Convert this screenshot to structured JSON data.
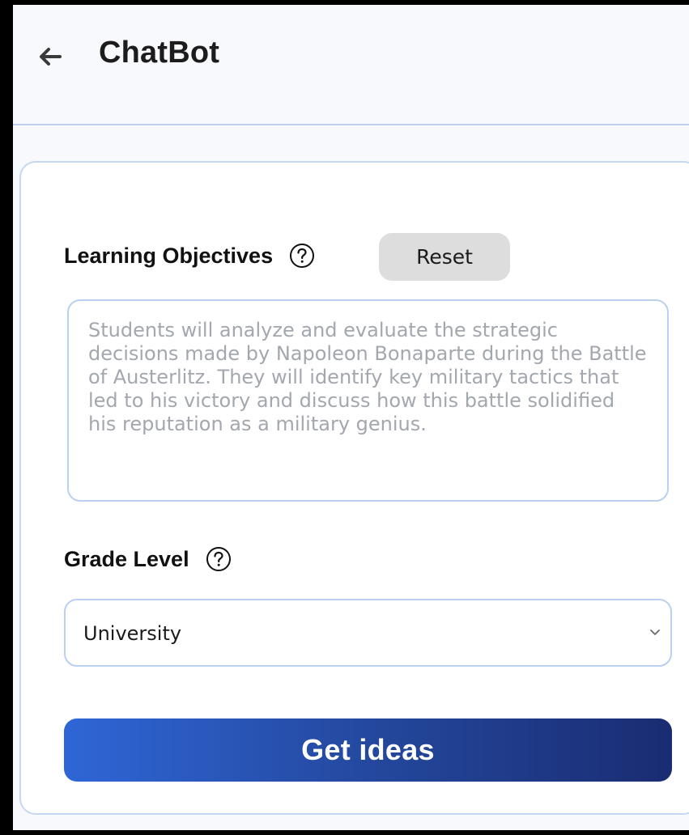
{
  "header": {
    "title": "ChatBot",
    "back_icon": "arrow-left-icon"
  },
  "form": {
    "objectives": {
      "label": "Learning Objectives",
      "help_icon": "question-circle-icon",
      "reset_label": "Reset",
      "placeholder": "Students will analyze and evaluate the strategic decisions made by Napoleon Bonaparte during the Battle of Austerlitz. They will identify key military tactics that led to his victory and discuss how this battle solidified his reputation as a military genius.",
      "value": ""
    },
    "grade": {
      "label": "Grade Level",
      "help_icon": "question-circle-icon",
      "selected": "University",
      "chevron_icon": "chevron-down-icon"
    },
    "submit_label": "Get ideas"
  },
  "colors": {
    "page_bg": "#f8f9fc",
    "card_border": "#c6d8ef",
    "input_border": "#b9d0ef",
    "reset_bg": "#dddddd",
    "button_gradient_start": "#2f66d6",
    "button_gradient_end": "#1a2c72",
    "placeholder_text": "#a3a7ae"
  }
}
